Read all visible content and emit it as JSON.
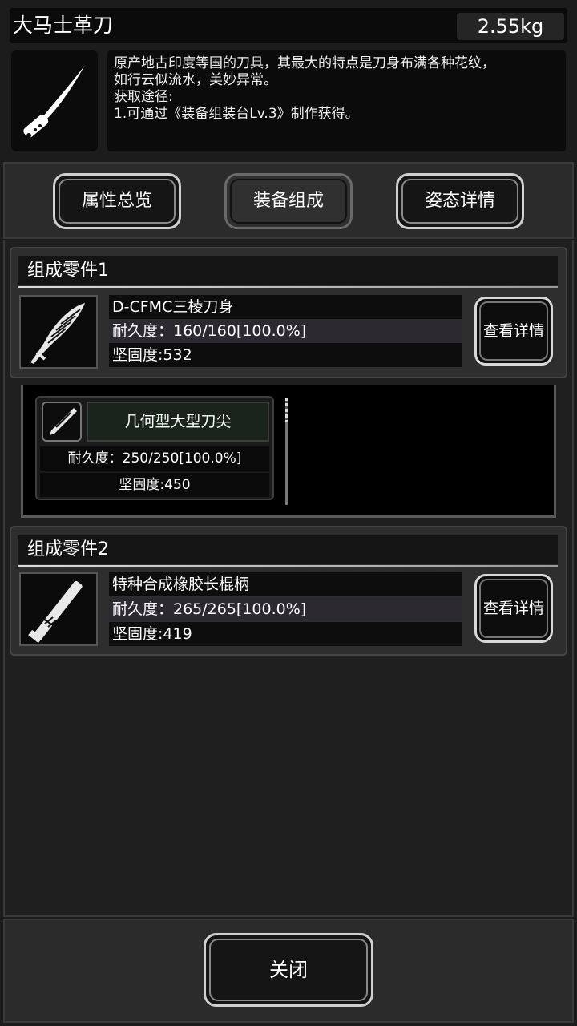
{
  "item": {
    "name": "大马士革刀",
    "weight": "2.55kg",
    "icon": "knife-icon",
    "description": [
      "原产地古印度等国的刀具，其最大的特点是刀身布满各种花纹，",
      "如行云似流水，美妙异常。",
      "获取途径:",
      "1.可通过《装备组装台Lv.3》制作获得。"
    ]
  },
  "tabs": [
    {
      "label": "属性总览",
      "active": false
    },
    {
      "label": "装备组成",
      "active": true
    },
    {
      "label": "姿态详情",
      "active": false
    }
  ],
  "parts": [
    {
      "header": "组成零件1",
      "name": "D-CFMC三棱刀身",
      "durability": "耐久度：160/160[100.0%]",
      "hardness": "坚固度:532",
      "detail_label": "查看详情",
      "icon": "feather-blade-icon"
    },
    {
      "header": "组成零件2",
      "name": "特种合成橡胶长棍柄",
      "durability": "耐久度：265/265[100.0%]",
      "hardness": "坚固度:419",
      "detail_label": "查看详情",
      "icon": "handle-icon"
    }
  ],
  "subpart": {
    "name": "几何型大型刀尖",
    "durability": "耐久度：250/250[100.0%]",
    "hardness": "坚固度:450",
    "icon": "blade-tip-icon"
  },
  "footer": {
    "close_label": "关闭"
  }
}
